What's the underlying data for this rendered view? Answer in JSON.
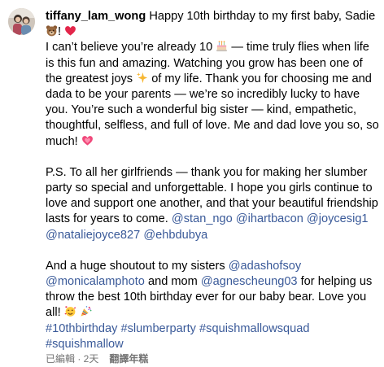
{
  "post": {
    "username": "tiffany_lam_wong",
    "line1_text": " Happy 10th birthday to my first baby, Sadie ",
    "line1_end": "! ",
    "para1_a": "I can’t believe you’re already 10 ",
    "para1_b": " — time truly flies when life is this fun and amazing. Watching you grow has been one of the greatest joys ",
    "para1_c": " of my life. Thank you for choosing me and dada to be your parents — we’re so incredibly lucky to have you. You’re such a wonderful big sister — kind, empathetic, thoughtful, selfless, and full of love. Me and dad love you so, so much! ",
    "para2_text": "P.S. To all her girlfriends — thank you for making her slumber party so special and unforgettable. I hope you girls continue to love and support one another, and that your beautiful friendship lasts for years to come. ",
    "para2_mentions": [
      "@stan_ngo",
      "@ihartbacon",
      "@joycesig1",
      "@nataliejoyce827",
      "@ehbdubya"
    ],
    "para3_a": "And a huge shoutout to my sisters ",
    "para3_mention1": "@adashofsoy",
    "para3_mention2": "@monicalamphoto",
    "para3_b": " and mom ",
    "para3_mention3": "@agnescheung03",
    "para3_c": " for helping us throw the best 10th birthday ever for our baby bear. Love you all! ",
    "hashtags": [
      "#10thbirthday",
      "#slumberparty",
      "#squishmallowsquad",
      "#squishmallow"
    ]
  },
  "emojis": {
    "bear": "bear-face-emoji",
    "heart": "red-heart-emoji",
    "cake": "birthday-cake-emoji",
    "sparkles": "sparkles-emoji",
    "growing_heart": "growing-heart-emoji",
    "hug_face": "smiling-face-with-hearts-emoji",
    "party": "party-popper-emoji"
  },
  "meta": {
    "edited_time": "已編輯 · 2天",
    "translate_label": "翻譯年糕"
  },
  "colors": {
    "link": "#3a5a99",
    "meta": "#737373",
    "text": "#000000"
  }
}
